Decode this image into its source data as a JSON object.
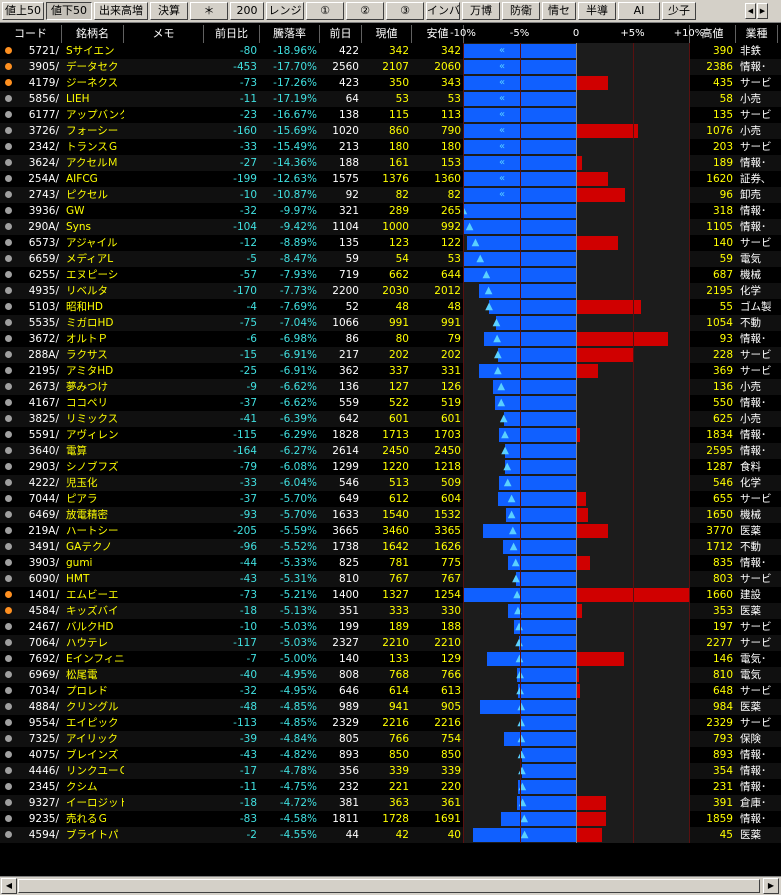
{
  "toolbar": {
    "tabs": [
      "値上50",
      "値下50",
      "出来高増",
      "決算",
      "＊",
      "200",
      "レンジ",
      "①",
      "②",
      "③",
      "インバ",
      "万博",
      "防衛",
      "情セ",
      "半導",
      "AI",
      "少子"
    ],
    "active_index": 1
  },
  "table": {
    "headers": [
      "コード",
      "銘柄名",
      "メモ",
      "前日比",
      "騰落率",
      "前日",
      "現値",
      "安値",
      "高値",
      "業種"
    ],
    "scale_ticks": [
      "-10%",
      "-5%",
      "0",
      "+5%",
      "+10%"
    ],
    "rows": [
      {
        "mark": "orange",
        "code": "5721/",
        "name": "Sサイエン",
        "change": "-80",
        "pct": "-18.96%",
        "prev": "422",
        "price": "342",
        "low": "342",
        "high": "390",
        "sector": "非鉄",
        "low_pct": -18.96,
        "high_pct": -7.58,
        "glyph": "chevron"
      },
      {
        "mark": "orange",
        "code": "3905/",
        "name": "データセク",
        "change": "-453",
        "pct": "-17.70%",
        "prev": "2560",
        "price": "2107",
        "low": "2060",
        "high": "2386",
        "sector": "情報･",
        "low_pct": -19.53,
        "high_pct": -6.8,
        "glyph": "chevron"
      },
      {
        "mark": "orange",
        "code": "4179/",
        "name": "ジーネクス",
        "change": "-73",
        "pct": "-17.26%",
        "prev": "423",
        "price": "350",
        "low": "343",
        "high": "435",
        "sector": "サービ",
        "low_pct": -18.91,
        "high_pct": 2.84,
        "glyph": "chevron"
      },
      {
        "mark": "gray",
        "code": "5856/",
        "name": "LIEH",
        "change": "-11",
        "pct": "-17.19%",
        "prev": "64",
        "price": "53",
        "low": "53",
        "high": "58",
        "sector": "小売",
        "low_pct": -17.19,
        "high_pct": -9.38,
        "glyph": "chevron"
      },
      {
        "mark": "gray",
        "code": "6177/",
        "name": "アップバンク",
        "change": "-23",
        "pct": "-16.67%",
        "prev": "138",
        "price": "115",
        "low": "113",
        "high": "135",
        "sector": "サービ",
        "low_pct": -18.12,
        "high_pct": -2.17,
        "glyph": "chevron"
      },
      {
        "mark": "gray",
        "code": "3726/",
        "name": "フォーシー",
        "change": "-160",
        "pct": "-15.69%",
        "prev": "1020",
        "price": "860",
        "low": "790",
        "high": "1076",
        "sector": "小売",
        "low_pct": -22.55,
        "high_pct": 5.49,
        "glyph": "chevron"
      },
      {
        "mark": "gray",
        "code": "2342/",
        "name": "トランスＧ",
        "change": "-33",
        "pct": "-15.49%",
        "prev": "213",
        "price": "180",
        "low": "180",
        "high": "203",
        "sector": "サービ",
        "low_pct": -15.49,
        "high_pct": -4.69,
        "glyph": "chevron"
      },
      {
        "mark": "gray",
        "code": "3624/",
        "name": "アクセルＭ",
        "change": "-27",
        "pct": "-14.36%",
        "prev": "188",
        "price": "161",
        "low": "153",
        "high": "189",
        "sector": "情報･",
        "low_pct": -18.62,
        "high_pct": 0.53,
        "glyph": "chevron"
      },
      {
        "mark": "gray",
        "code": "254A/",
        "name": "AIFCG",
        "change": "-199",
        "pct": "-12.63%",
        "prev": "1575",
        "price": "1376",
        "low": "1360",
        "high": "1620",
        "sector": "証券､",
        "low_pct": -13.65,
        "high_pct": 2.86,
        "glyph": "chevron"
      },
      {
        "mark": "gray",
        "code": "2743/",
        "name": "ピクセル",
        "change": "-10",
        "pct": "-10.87%",
        "prev": "92",
        "price": "82",
        "low": "82",
        "high": "96",
        "sector": "卸売",
        "low_pct": -10.87,
        "high_pct": 4.35,
        "glyph": "chevron"
      },
      {
        "mark": "gray",
        "code": "3936/",
        "name": "GW",
        "change": "-32",
        "pct": "-9.97%",
        "prev": "321",
        "price": "289",
        "low": "265",
        "high": "318",
        "sector": "情報･",
        "low_pct": -17.45,
        "high_pct": -0.93,
        "glyph": "triangle"
      },
      {
        "mark": "gray",
        "code": "290A/",
        "name": "Syns",
        "change": "-104",
        "pct": "-9.42%",
        "prev": "1104",
        "price": "1000",
        "low": "992",
        "high": "1105",
        "sector": "情報･",
        "low_pct": -10.14,
        "high_pct": 0.09,
        "glyph": "triangle"
      },
      {
        "mark": "gray",
        "code": "6573/",
        "name": "アジャイル",
        "change": "-12",
        "pct": "-8.89%",
        "prev": "135",
        "price": "123",
        "low": "122",
        "high": "140",
        "sector": "サービ",
        "low_pct": -9.63,
        "high_pct": 3.7,
        "glyph": "triangle"
      },
      {
        "mark": "gray",
        "code": "6659/",
        "name": "メディアL",
        "change": "-5",
        "pct": "-8.47%",
        "prev": "59",
        "price": "54",
        "low": "53",
        "high": "59",
        "sector": "電気",
        "low_pct": -10.17,
        "high_pct": 0,
        "glyph": "triangle"
      },
      {
        "mark": "gray",
        "code": "6255/",
        "name": "エヌピーシ",
        "change": "-57",
        "pct": "-7.93%",
        "prev": "719",
        "price": "662",
        "low": "644",
        "high": "687",
        "sector": "機械",
        "low_pct": -10.43,
        "high_pct": -4.45,
        "glyph": "triangle"
      },
      {
        "mark": "gray",
        "code": "4935/",
        "name": "リベルタ",
        "change": "-170",
        "pct": "-7.73%",
        "prev": "2200",
        "price": "2030",
        "low": "2012",
        "high": "2195",
        "sector": "化学",
        "low_pct": -8.55,
        "high_pct": -0.23,
        "glyph": "triangle"
      },
      {
        "mark": "gray",
        "code": "5103/",
        "name": "昭和HD",
        "change": "-4",
        "pct": "-7.69%",
        "prev": "52",
        "price": "48",
        "low": "48",
        "high": "55",
        "sector": "ゴム製",
        "low_pct": -7.69,
        "high_pct": 5.77,
        "glyph": "triangle"
      },
      {
        "mark": "gray",
        "code": "5535/",
        "name": "ミガロHD",
        "change": "-75",
        "pct": "-7.04%",
        "prev": "1066",
        "price": "991",
        "low": "991",
        "high": "1054",
        "sector": "不動",
        "low_pct": -7.04,
        "high_pct": -1.13,
        "glyph": "triangle"
      },
      {
        "mark": "gray",
        "code": "3672/",
        "name": "オルトＰ",
        "change": "-6",
        "pct": "-6.98%",
        "prev": "86",
        "price": "80",
        "low": "79",
        "high": "93",
        "sector": "情報･",
        "low_pct": -8.14,
        "high_pct": 8.14,
        "glyph": "triangle"
      },
      {
        "mark": "gray",
        "code": "288A/",
        "name": "ラクサス",
        "change": "-15",
        "pct": "-6.91%",
        "prev": "217",
        "price": "202",
        "low": "202",
        "high": "228",
        "sector": "サービ",
        "low_pct": -6.91,
        "high_pct": 5.07,
        "glyph": "triangle"
      },
      {
        "mark": "gray",
        "code": "2195/",
        "name": "アミタHD",
        "change": "-25",
        "pct": "-6.91%",
        "prev": "362",
        "price": "337",
        "low": "331",
        "high": "369",
        "sector": "サービ",
        "low_pct": -8.56,
        "high_pct": 1.93,
        "glyph": "triangle"
      },
      {
        "mark": "gray",
        "code": "2673/",
        "name": "夢みつけ",
        "change": "-9",
        "pct": "-6.62%",
        "prev": "136",
        "price": "127",
        "low": "126",
        "high": "136",
        "sector": "小売",
        "low_pct": -7.35,
        "high_pct": 0,
        "glyph": "triangle"
      },
      {
        "mark": "gray",
        "code": "4167/",
        "name": "ココペリ",
        "change": "-37",
        "pct": "-6.62%",
        "prev": "559",
        "price": "522",
        "low": "519",
        "high": "550",
        "sector": "情報･",
        "low_pct": -7.16,
        "high_pct": -1.61,
        "glyph": "triangle"
      },
      {
        "mark": "gray",
        "code": "3825/",
        "name": "リミックス",
        "change": "-41",
        "pct": "-6.39%",
        "prev": "642",
        "price": "601",
        "low": "601",
        "high": "625",
        "sector": "小売",
        "low_pct": -6.39,
        "high_pct": -2.65,
        "glyph": "triangle"
      },
      {
        "mark": "gray",
        "code": "5591/",
        "name": "アヴィレン",
        "change": "-115",
        "pct": "-6.29%",
        "prev": "1828",
        "price": "1713",
        "low": "1703",
        "high": "1834",
        "sector": "情報･",
        "low_pct": -6.84,
        "high_pct": 0.33,
        "glyph": "triangle"
      },
      {
        "mark": "gray",
        "code": "3640/",
        "name": "電算",
        "change": "-164",
        "pct": "-6.27%",
        "prev": "2614",
        "price": "2450",
        "low": "2450",
        "high": "2595",
        "sector": "情報･",
        "low_pct": -6.27,
        "high_pct": -0.73,
        "glyph": "triangle"
      },
      {
        "mark": "gray",
        "code": "2903/",
        "name": "シノブフズ",
        "change": "-79",
        "pct": "-6.08%",
        "prev": "1299",
        "price": "1220",
        "low": "1218",
        "high": "1287",
        "sector": "食料",
        "low_pct": -6.24,
        "high_pct": -0.92,
        "glyph": "triangle"
      },
      {
        "mark": "gray",
        "code": "4222/",
        "name": "児玉化",
        "change": "-33",
        "pct": "-6.04%",
        "prev": "546",
        "price": "513",
        "low": "509",
        "high": "546",
        "sector": "化学",
        "low_pct": -6.78,
        "high_pct": 0,
        "glyph": "triangle"
      },
      {
        "mark": "gray",
        "code": "7044/",
        "name": "ピアラ",
        "change": "-37",
        "pct": "-5.70%",
        "prev": "649",
        "price": "612",
        "low": "604",
        "high": "655",
        "sector": "サービ",
        "low_pct": -6.93,
        "high_pct": 0.92,
        "glyph": "triangle"
      },
      {
        "mark": "gray",
        "code": "6469/",
        "name": "放電精密",
        "change": "-93",
        "pct": "-5.70%",
        "prev": "1633",
        "price": "1540",
        "low": "1532",
        "high": "1650",
        "sector": "機械",
        "low_pct": -6.18,
        "high_pct": 1.04,
        "glyph": "triangle"
      },
      {
        "mark": "gray",
        "code": "219A/",
        "name": "ハートシー",
        "change": "-205",
        "pct": "-5.59%",
        "prev": "3665",
        "price": "3460",
        "low": "3365",
        "high": "3770",
        "sector": "医薬",
        "low_pct": -8.19,
        "high_pct": 2.86,
        "glyph": "triangle"
      },
      {
        "mark": "gray",
        "code": "3491/",
        "name": "GAテクノ",
        "change": "-96",
        "pct": "-5.52%",
        "prev": "1738",
        "price": "1642",
        "low": "1626",
        "high": "1712",
        "sector": "不動",
        "low_pct": -6.44,
        "high_pct": -1.5,
        "glyph": "triangle"
      },
      {
        "mark": "gray",
        "code": "3903/",
        "name": "gumi",
        "change": "-44",
        "pct": "-5.33%",
        "prev": "825",
        "price": "781",
        "low": "775",
        "high": "835",
        "sector": "情報･",
        "low_pct": -6.06,
        "high_pct": 1.21,
        "glyph": "triangle"
      },
      {
        "mark": "gray",
        "code": "6090/",
        "name": "HMT",
        "change": "-43",
        "pct": "-5.31%",
        "prev": "810",
        "price": "767",
        "low": "767",
        "high": "803",
        "sector": "サービ",
        "low_pct": -5.31,
        "high_pct": -0.86,
        "glyph": "triangle"
      },
      {
        "mark": "orange",
        "code": "1401/",
        "name": "エムビーエ",
        "change": "-73",
        "pct": "-5.21%",
        "prev": "1400",
        "price": "1327",
        "low": "1254",
        "high": "1660",
        "sector": "建設",
        "low_pct": -10.43,
        "high_pct": 18.57,
        "glyph": "triangle"
      },
      {
        "mark": "orange",
        "code": "4584/",
        "name": "キッズバイ",
        "change": "-18",
        "pct": "-5.13%",
        "prev": "351",
        "price": "333",
        "low": "330",
        "high": "353",
        "sector": "医薬",
        "low_pct": -5.98,
        "high_pct": 0.57,
        "glyph": "triangle"
      },
      {
        "mark": "gray",
        "code": "2467/",
        "name": "バルクHD",
        "change": "-10",
        "pct": "-5.03%",
        "prev": "199",
        "price": "189",
        "low": "188",
        "high": "197",
        "sector": "サービ",
        "low_pct": -5.53,
        "high_pct": -1.01,
        "glyph": "triangle"
      },
      {
        "mark": "gray",
        "code": "7064/",
        "name": "ハウテレ",
        "change": "-117",
        "pct": "-5.03%",
        "prev": "2327",
        "price": "2210",
        "low": "2210",
        "high": "2277",
        "sector": "サービ",
        "low_pct": -5.03,
        "high_pct": -2.15,
        "glyph": "triangle"
      },
      {
        "mark": "gray",
        "code": "7692/",
        "name": "Eインフィニ",
        "change": "-7",
        "pct": "-5.00%",
        "prev": "140",
        "price": "133",
        "low": "129",
        "high": "146",
        "sector": "電気･",
        "low_pct": -7.86,
        "high_pct": 4.29,
        "glyph": "triangle"
      },
      {
        "mark": "gray",
        "code": "6969/",
        "name": "松尾電",
        "change": "-40",
        "pct": "-4.95%",
        "prev": "808",
        "price": "768",
        "low": "766",
        "high": "810",
        "sector": "電気",
        "low_pct": -5.2,
        "high_pct": 0.25,
        "glyph": "triangle"
      },
      {
        "mark": "gray",
        "code": "7034/",
        "name": "プロレド",
        "change": "-32",
        "pct": "-4.95%",
        "prev": "646",
        "price": "614",
        "low": "613",
        "high": "648",
        "sector": "サービ",
        "low_pct": -5.11,
        "high_pct": 0.31,
        "glyph": "triangle"
      },
      {
        "mark": "gray",
        "code": "4884/",
        "name": "クリングル",
        "change": "-48",
        "pct": "-4.85%",
        "prev": "989",
        "price": "941",
        "low": "905",
        "high": "984",
        "sector": "医薬",
        "low_pct": -8.49,
        "high_pct": -0.51,
        "glyph": "triangle"
      },
      {
        "mark": "gray",
        "code": "9554/",
        "name": "エイピック",
        "change": "-113",
        "pct": "-4.85%",
        "prev": "2329",
        "price": "2216",
        "low": "2216",
        "high": "2329",
        "sector": "サービ",
        "low_pct": -4.85,
        "high_pct": 0,
        "glyph": "triangle"
      },
      {
        "mark": "gray",
        "code": "7325/",
        "name": "アイリック",
        "change": "-39",
        "pct": "-4.84%",
        "prev": "805",
        "price": "766",
        "low": "754",
        "high": "793",
        "sector": "保険",
        "low_pct": -6.34,
        "high_pct": -1.49,
        "glyph": "triangle"
      },
      {
        "mark": "gray",
        "code": "4075/",
        "name": "ブレインズ",
        "change": "-43",
        "pct": "-4.82%",
        "prev": "893",
        "price": "850",
        "low": "850",
        "high": "893",
        "sector": "情報･",
        "low_pct": -4.82,
        "high_pct": 0,
        "glyph": "triangle"
      },
      {
        "mark": "gray",
        "code": "4446/",
        "name": "リンクユーＧ",
        "change": "-17",
        "pct": "-4.78%",
        "prev": "356",
        "price": "339",
        "low": "339",
        "high": "354",
        "sector": "情報･",
        "low_pct": -4.78,
        "high_pct": -0.56,
        "glyph": "triangle"
      },
      {
        "mark": "gray",
        "code": "2345/",
        "name": "クシム",
        "change": "-11",
        "pct": "-4.75%",
        "prev": "232",
        "price": "221",
        "low": "220",
        "high": "231",
        "sector": "情報･",
        "low_pct": -5.17,
        "high_pct": -0.43,
        "glyph": "triangle"
      },
      {
        "mark": "gray",
        "code": "9327/",
        "name": "イーロジット",
        "change": "-18",
        "pct": "-4.72%",
        "prev": "381",
        "price": "363",
        "low": "361",
        "high": "391",
        "sector": "倉庫･",
        "low_pct": -5.25,
        "high_pct": 2.62,
        "glyph": "triangle"
      },
      {
        "mark": "gray",
        "code": "9235/",
        "name": "売れるＧ",
        "change": "-83",
        "pct": "-4.58%",
        "prev": "1811",
        "price": "1728",
        "low": "1691",
        "high": "1859",
        "sector": "情報･",
        "low_pct": -6.63,
        "high_pct": 2.65,
        "glyph": "triangle"
      },
      {
        "mark": "gray",
        "code": "4594/",
        "name": "ブライトパ",
        "change": "-2",
        "pct": "-4.55%",
        "prev": "44",
        "price": "42",
        "low": "40",
        "high": "45",
        "sector": "医薬",
        "low_pct": -9.09,
        "high_pct": 2.27,
        "glyph": "triangle"
      }
    ]
  },
  "colors": {
    "code": "#ffffff",
    "name": "#ffff00",
    "numbers": "#ffffff",
    "change": "#40e0e0",
    "bar_down": "#1060ff",
    "bar_up": "#d00000",
    "glyph": "#5ad0ff",
    "mark_orange": "#ff9020",
    "mark_gray": "#a0a0a0"
  }
}
